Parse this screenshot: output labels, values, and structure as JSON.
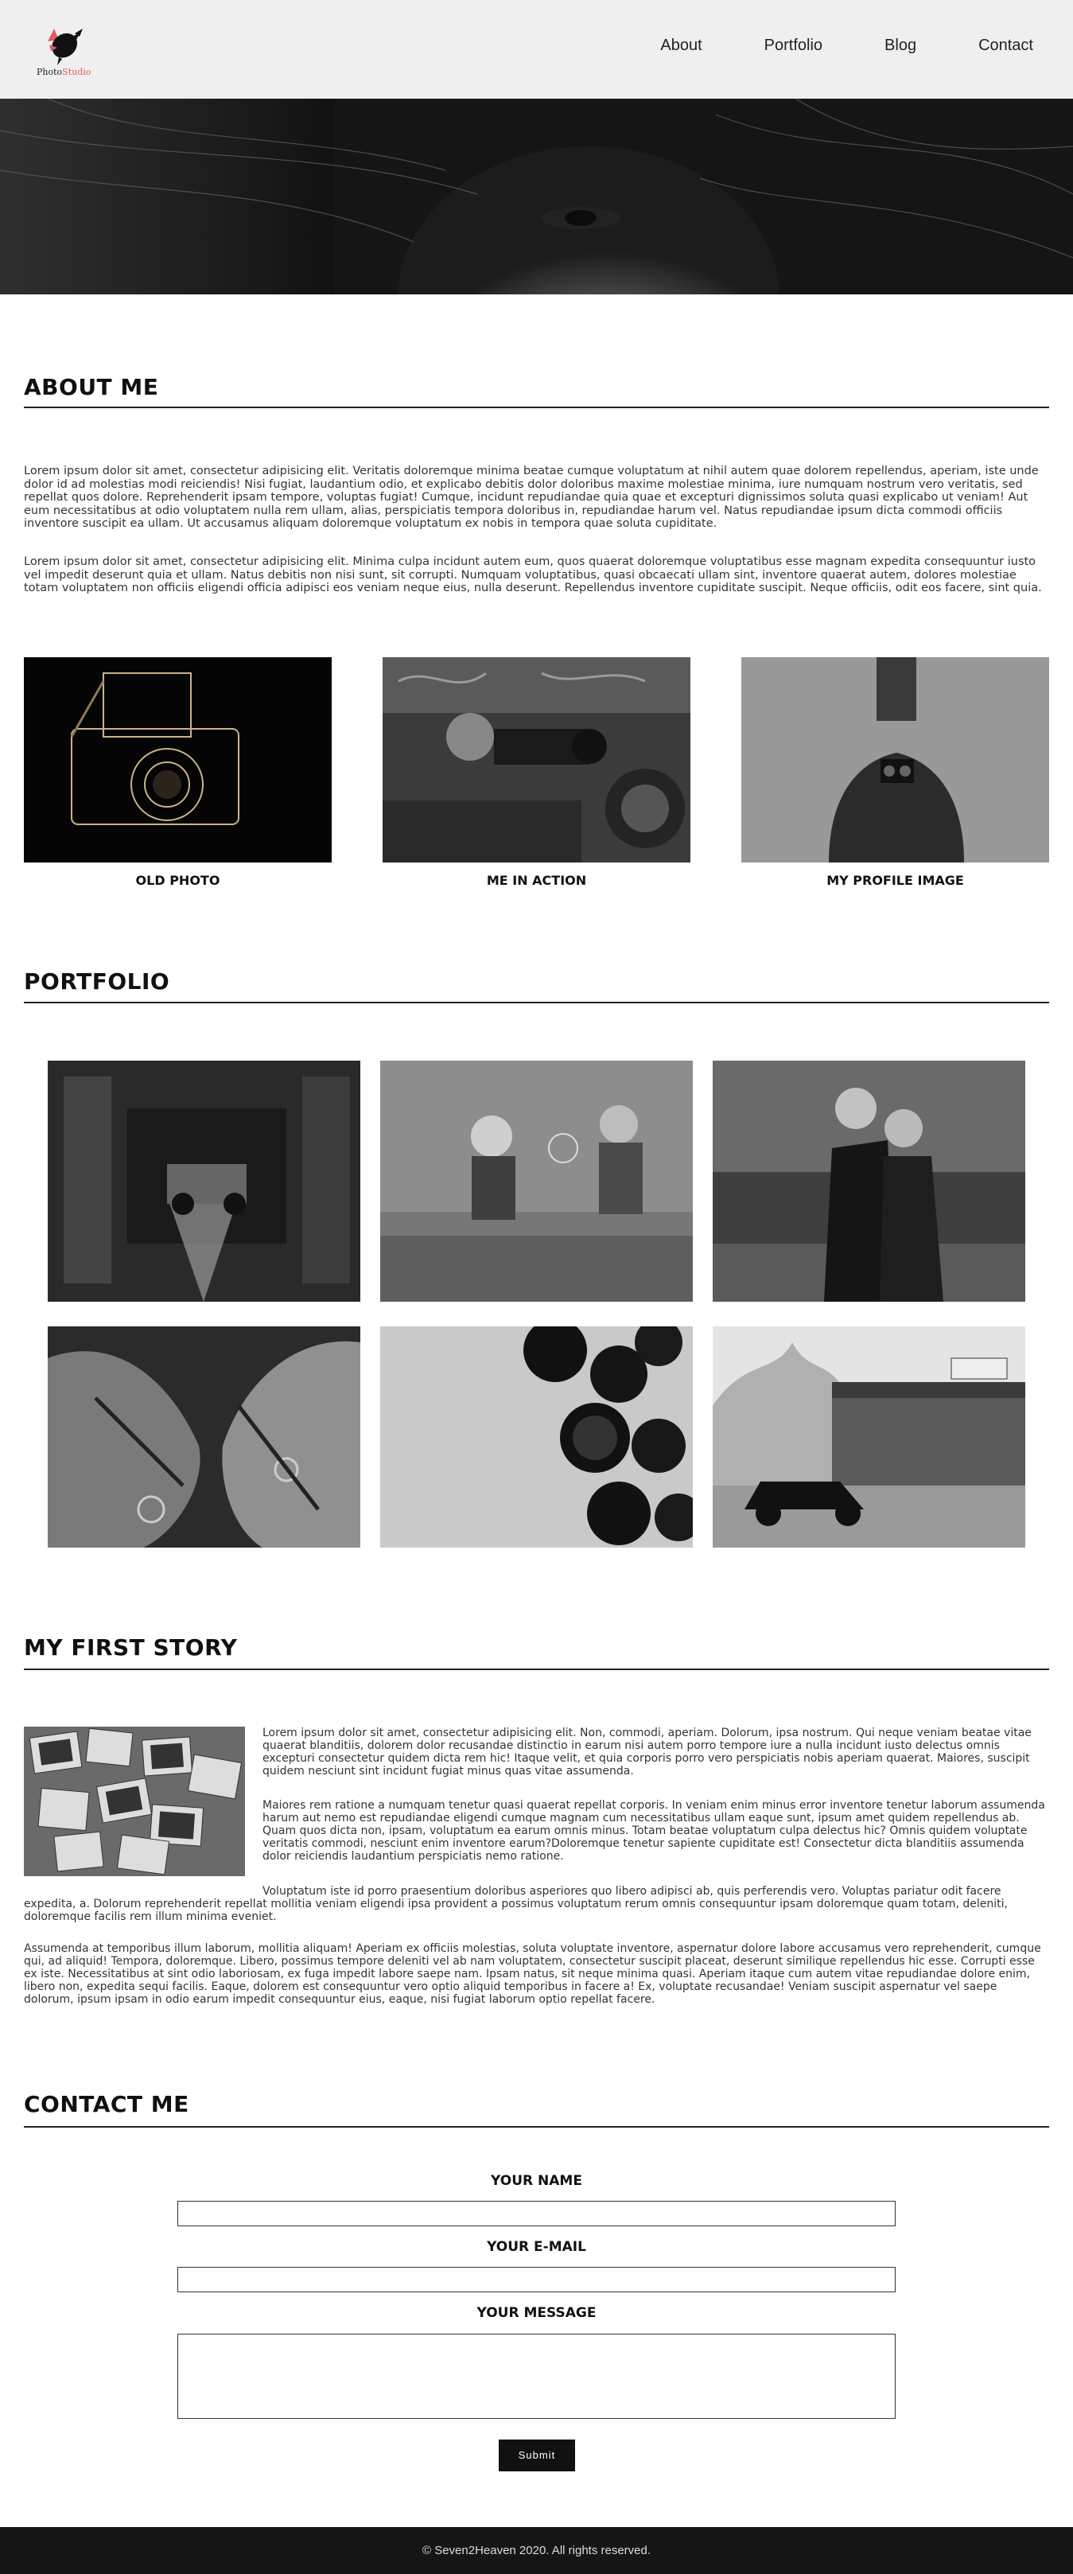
{
  "header": {
    "logo_text_a": "Photo",
    "logo_text_b": "Studio",
    "nav": [
      {
        "label": "About"
      },
      {
        "label": "Portfolio"
      },
      {
        "label": "Blog"
      },
      {
        "label": "Contact"
      }
    ]
  },
  "about": {
    "title": "ABOUT ME",
    "p1": "Lorem ipsum dolor sit amet, consectetur adipisicing elit. Veritatis doloremque minima beatae cumque voluptatum at nihil autem quae dolorem repellendus, aperiam, iste unde dolor id ad molestias modi reiciendis! Nisi fugiat, laudantium odio, et explicabo debitis dolor doloribus maxime molestiae minima, iure numquam nostrum vero veritatis, sed repellat quos dolore. Reprehenderit ipsam tempore, voluptas fugiat! Cumque, incidunt repudiandae quia quae et excepturi dignissimos soluta quasi explicabo ut veniam! Aut eum necessitatibus at odio voluptatem nulla rem ullam, alias, perspiciatis tempora doloribus in, repudiandae harum vel. Natus repudiandae ipsum dicta commodi officiis inventore suscipit ea ullam. Ut accusamus aliquam doloremque voluptatum ex nobis in tempora quae soluta cupiditate.",
    "p2": "Lorem ipsum dolor sit amet, consectetur adipisicing elit. Minima culpa incidunt autem eum, quos quaerat doloremque voluptatibus esse magnam expedita consequuntur iusto vel impedit deserunt quia et ullam. Natus debitis non nisi sunt, sit corrupti. Numquam voluptatibus, quasi obcaecati ullam sint, inventore quaerat autem, dolores molestiae totam voluptatem non officiis eligendi officia adipisci eos veniam neque eius, nulla deserunt. Repellendus inventore cupiditate suscipit. Neque officiis, odit eos facere, sint quia.",
    "captions": [
      "OLD PHOTO",
      "ME IN ACTION",
      "MY PROFILE IMAGE"
    ]
  },
  "portfolio": {
    "title": "PORTFOLIO"
  },
  "story": {
    "title": "MY FIRST STORY",
    "p1": "Lorem ipsum dolor sit amet, consectetur adipisicing elit. Non, commodi, aperiam. Dolorum, ipsa nostrum. Qui neque veniam beatae vitae quaerat blanditiis, dolorem dolor recusandae distinctio in earum nisi autem porro tempore iure a nulla incidunt iusto delectus omnis excepturi consectetur quidem dicta rem hic! Itaque velit, et quia corporis porro vero perspiciatis nobis aperiam quaerat. Maiores, suscipit quidem nesciunt sint incidunt fugiat minus quas vitae assumenda.",
    "p2": "Maiores rem ratione a numquam tenetur quasi quaerat repellat corporis. In veniam enim minus error inventore tenetur laborum assumenda harum aut nemo est repudiandae eligendi cumque magnam cum necessitatibus ullam eaque sunt, ipsum amet quidem repellendus ab. Quam quos dicta non, ipsam, voluptatum ea earum omnis minus. Totam beatae voluptatum culpa delectus hic? Omnis quidem voluptate veritatis commodi, nesciunt enim inventore earum?Doloremque tenetur sapiente cupiditate est! Consectetur dicta blanditiis assumenda dolor reiciendis laudantium perspiciatis nemo ratione.",
    "p3": "Voluptatum iste id porro praesentium doloribus asperiores quo libero adipisci ab, quis perferendis vero. Voluptas pariatur odit facere expedita, a. Dolorum reprehenderit repellat mollitia veniam eligendi ipsa provident a possimus voluptatum rerum omnis consequuntur ipsam doloremque quam totam, deleniti, doloremque facilis rem illum minima eveniet.",
    "p4": "Assumenda at temporibus illum laborum, mollitia aliquam! Aperiam ex officiis molestias, soluta voluptate inventore, aspernatur dolore labore accusamus vero reprehenderit, cumque qui, ad aliquid! Tempora, doloremque. Libero, possimus tempore deleniti vel ab nam voluptatem, consectetur suscipit placeat, deserunt similique repellendus hic esse. Corrupti esse ex iste. Necessitatibus at sint odio laboriosam, ex fuga impedit labore saepe nam. Ipsam natus, sit neque minima quasi. Aperiam itaque cum autem vitae repudiandae dolore enim, libero non, expedita sequi facilis. Eaque, dolorem est consequuntur vero optio aliquid temporibus in facere a! Ex, voluptate recusandae! Veniam suscipit aspernatur vel saepe dolorum, ipsum ipsam in odio earum impedit consequuntur eius, eaque, nisi fugiat laborum optio repellat facere."
  },
  "contact": {
    "title": "CONTACT ME",
    "name_label": "YOUR NAME",
    "email_label": "YOUR E-MAIL",
    "message_label": "YOUR MESSAGE",
    "submit_label": "Submit"
  },
  "footer": {
    "text": "© Seven2Heaven 2020. All rights reserved."
  },
  "colors": {
    "header_bg": "#efefef",
    "accent": "#e05b63",
    "footer_bg": "#161616"
  }
}
